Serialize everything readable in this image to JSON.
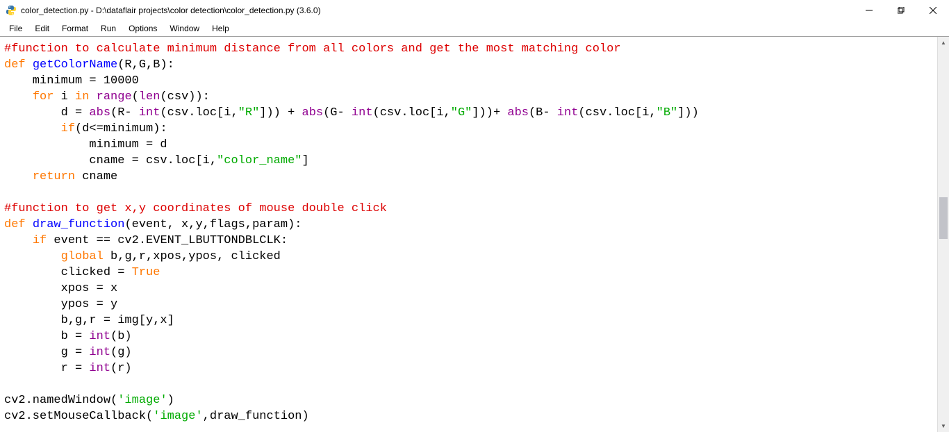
{
  "titlebar": {
    "text": "color_detection.py - D:\\dataflair projects\\color detection\\color_detection.py (3.6.0)"
  },
  "menus": [
    "File",
    "Edit",
    "Format",
    "Run",
    "Options",
    "Window",
    "Help"
  ],
  "code": {
    "comment1": "#function to calculate minimum distance from all colors and get the most matching color",
    "kw_def": "def",
    "fn_getcolor": "getColorName",
    "params_getcolor": "(R,G,B):",
    "line_min": "    minimum = 10000",
    "kw_for": "for",
    "var_i": " i ",
    "kw_in": "in",
    "fn_range": " range",
    "fn_len": "len",
    "txt_csv_paren": "(csv)):",
    "indent8": "        d = ",
    "fn_abs": "abs",
    "txt_R": "(R- ",
    "fn_int": "int",
    "txt_csvloc_open": "(csv.loc[i,",
    "str_R": "\"R\"",
    "txt_close_plus": "])) + ",
    "txt_G": "(G- ",
    "str_G": "\"G\"",
    "txt_close_plus2": "]))+ ",
    "txt_B": "(B- ",
    "str_B": "\"B\"",
    "txt_close_end": "]))",
    "line_if": "        ",
    "kw_if": "if",
    "txt_ifcond": "(d<=minimum):",
    "line_min_d": "            minimum = d",
    "line_cname": "            cname = csv.loc[i,",
    "str_colorname": "\"color_name\"",
    "txt_bracket_close": "]",
    "kw_return": "return",
    "txt_cname": " cname",
    "indent4": "    ",
    "comment2": "#function to get x,y coordinates of mouse double click",
    "fn_draw": "draw_function",
    "params_draw": "(event, x,y,flags,param):",
    "txt_eventeq": " event == cv2.EVENT_LBUTTONDBLCLK:",
    "kw_global": "global",
    "txt_globals": " b,g,r,xpos,ypos, clicked",
    "txt_clicked": "        clicked = ",
    "kw_true": "True",
    "line_xpos": "        xpos = x",
    "line_ypos": "        ypos = y",
    "line_bgr": "        b,g,r = img[y,x]",
    "line_b": "        b = ",
    "txt_b_paren": "(b)",
    "line_g": "        g = ",
    "txt_g_paren": "(g)",
    "line_r": "        r = ",
    "txt_r_paren": "(r)",
    "line_namedwin": "cv2.namedWindow(",
    "str_image": "'image'",
    "txt_paren_close": ")",
    "line_setmouse": "cv2.setMouseCallback(",
    "txt_comma_draw": ",draw_function)"
  }
}
